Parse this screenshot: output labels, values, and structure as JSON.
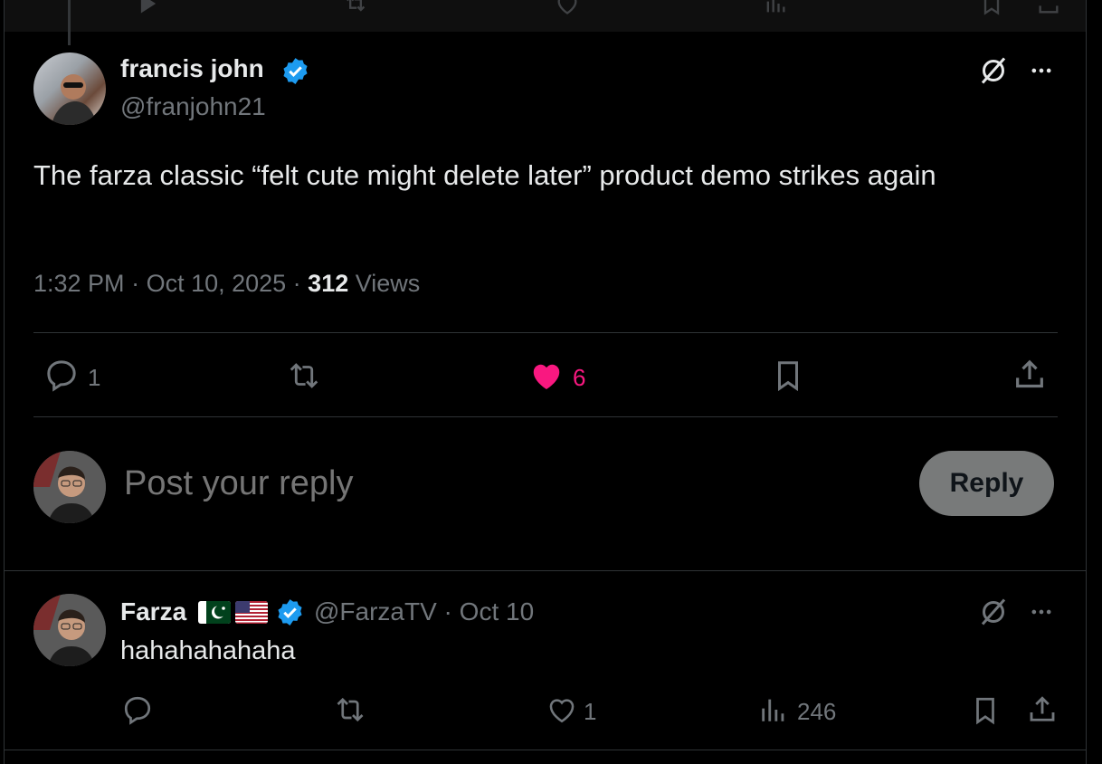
{
  "main_post": {
    "author_name": "francis john",
    "author_handle": "@franjohn21",
    "text": "The farza classic “felt cute might delete later” product demo strikes again",
    "time": "1:32 PM",
    "date": "Oct 10, 2025",
    "views_count": "312",
    "views_label": "Views",
    "actions": {
      "replies": "1",
      "likes": "6"
    }
  },
  "composer": {
    "placeholder": "Post your reply",
    "button_label": "Reply"
  },
  "reply_post": {
    "author_name": "Farza",
    "author_handle": "@FarzaTV",
    "date": "Oct 10",
    "text": "hahahahahaha",
    "actions": {
      "likes": "1",
      "views": "246"
    }
  },
  "colors": {
    "like": "#f91880",
    "verified": "#1d9bf0",
    "muted": "#71767b"
  },
  "icons": [
    "grok-icon",
    "more-icon",
    "verified-icon",
    "reply-icon",
    "repost-icon",
    "heart-icon",
    "bookmark-icon",
    "share-icon",
    "views-icon"
  ]
}
